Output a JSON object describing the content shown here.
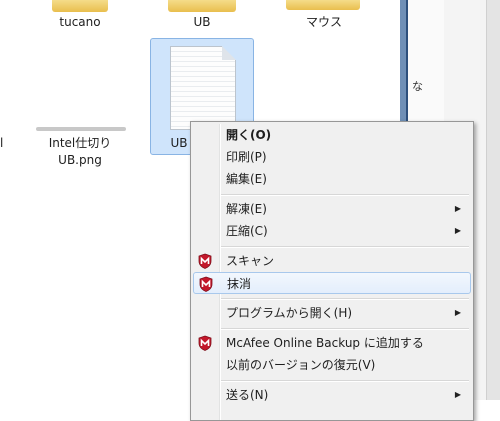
{
  "explorer": {
    "folders": [
      {
        "label": "tucano"
      },
      {
        "label": "UB"
      },
      {
        "label": "マウス"
      }
    ],
    "files": [
      {
        "label": "Intel仕切り\nUB.png",
        "line1": "Intel仕切り",
        "line2": "UB.png"
      },
      {
        "label": "UB",
        "selected": true
      }
    ],
    "left_edge_glyph": "l",
    "right_edge_glyph": "な"
  },
  "context_menu": {
    "items": [
      {
        "label": "開く(O)",
        "bold": true
      },
      {
        "label": "印刷(P)"
      },
      {
        "label": "編集(E)"
      },
      {
        "label": "解凍(E)",
        "submenu": true
      },
      {
        "label": "圧縮(C)",
        "submenu": true
      },
      {
        "label": "スキャン",
        "icon": "mcafee-shield-icon"
      },
      {
        "label": "抹消",
        "icon": "mcafee-shield-icon",
        "highlighted": true
      },
      {
        "label": "プログラムから開く(H)",
        "submenu": true
      },
      {
        "label": "McAfee Online Backup に追加する",
        "icon": "mcafee-shield-icon"
      },
      {
        "label": "以前のバージョンの復元(V)"
      },
      {
        "label": "送る(N)",
        "submenu": true
      }
    ],
    "submenu_arrow": "▶"
  },
  "colors": {
    "selection_fill": "#cfe4fb",
    "selection_border": "#89b4e4",
    "menu_bg": "#f0f0f0",
    "mcafee_red": "#c3182b",
    "folder_yellow": "#e9be4e"
  }
}
